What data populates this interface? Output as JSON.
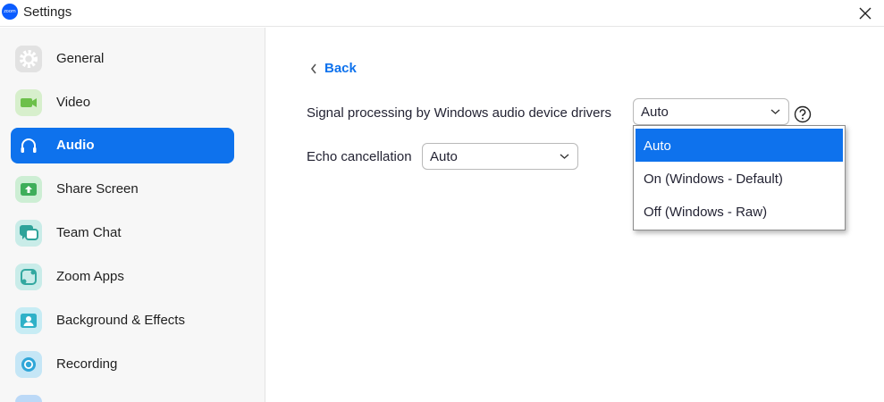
{
  "window": {
    "title": "Settings",
    "logo_text": "zoom"
  },
  "sidebar": {
    "items": [
      {
        "label": "General",
        "icon": "gear-icon",
        "color": "#8e8e8e"
      },
      {
        "label": "Video",
        "icon": "video-camera-icon",
        "color": "#6cc04a"
      },
      {
        "label": "Audio",
        "icon": "headphones-icon",
        "color": "#ffffff",
        "active": true
      },
      {
        "label": "Share Screen",
        "icon": "share-screen-icon",
        "color": "#3fae5a"
      },
      {
        "label": "Team Chat",
        "icon": "chat-bubble-icon",
        "color": "#2fa39a"
      },
      {
        "label": "Zoom Apps",
        "icon": "zoom-apps-icon",
        "color": "#33a8a0"
      },
      {
        "label": "Background & Effects",
        "icon": "background-effects-icon",
        "color": "#2fb1c8"
      },
      {
        "label": "Recording",
        "icon": "record-icon",
        "color": "#2fa6d8"
      }
    ]
  },
  "main": {
    "back_label": "Back",
    "signal_processing": {
      "label": "Signal processing by Windows audio device drivers",
      "value": "Auto",
      "options": [
        "Auto",
        "On (Windows - Default)",
        "Off (Windows - Raw)"
      ],
      "selected_index": 0
    },
    "echo_cancellation": {
      "label": "Echo cancellation",
      "value": "Auto"
    },
    "help_icon": "question-mark-icon"
  },
  "colors": {
    "accent": "#0e72ed",
    "sidebar_bg": "#f7f7f7"
  }
}
